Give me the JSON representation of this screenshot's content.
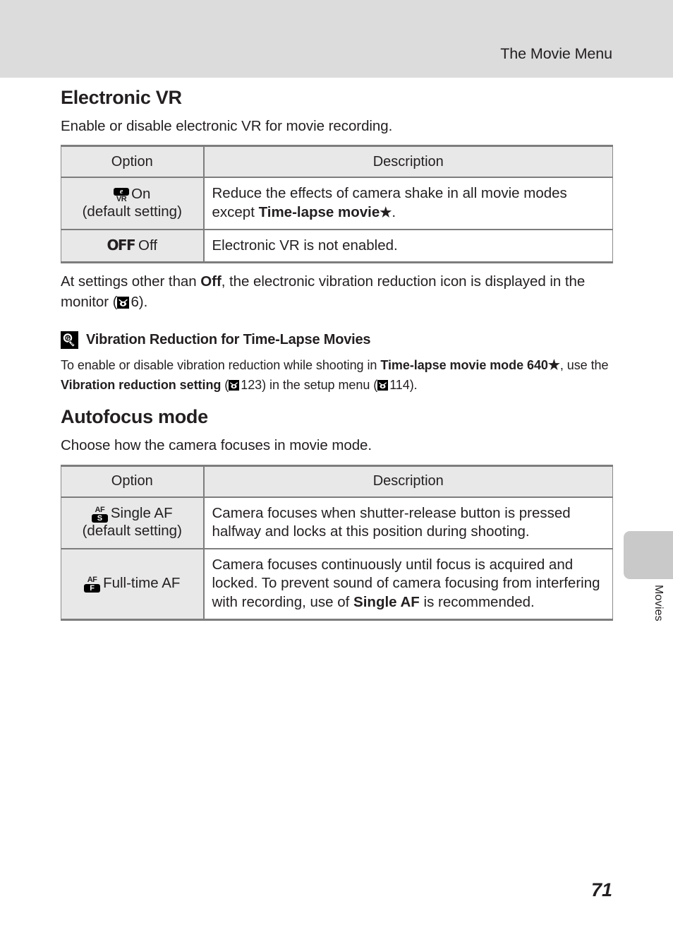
{
  "header": {
    "title": "The Movie Menu"
  },
  "sections": [
    {
      "id": "electronic-vr",
      "title": "Electronic VR",
      "lead": "Enable or disable electronic VR for movie recording.",
      "table": {
        "columns": [
          "Option",
          "Description"
        ],
        "rows": [
          {
            "icon": "vr-on-icon",
            "icon_top": "e",
            "icon_bottom": "VR",
            "option": "On",
            "option_sub": "(default setting)",
            "description_pre": "Reduce the effects of camera shake in all movie modes except ",
            "description_bold": "Time-lapse movie",
            "description_star": "★",
            "description_post": "."
          },
          {
            "icon": "off-icon",
            "icon_glyph": "OFF",
            "option": "Off",
            "option_sub": "",
            "description_pre": "Electronic VR is not enabled.",
            "description_bold": "",
            "description_star": "",
            "description_post": ""
          }
        ]
      },
      "after_table": {
        "pre": "At settings other than ",
        "bold": "Off",
        "mid": ", the electronic vibration reduction icon is displayed in the monitor (",
        "xref_page": "6",
        "post": ")."
      }
    },
    {
      "id": "autofocus-mode",
      "title": "Autofocus mode",
      "lead": "Choose how the camera focuses in movie mode.",
      "table": {
        "columns": [
          "Option",
          "Description"
        ],
        "rows": [
          {
            "icon": "af-single-icon",
            "icon_top": "AF",
            "icon_bottom": "S",
            "option": "Single AF",
            "option_sub": "(default setting)",
            "description_pre": "Camera focuses when shutter-release button is pressed halfway and locks at this position during shooting.",
            "description_bold": "",
            "description_post": ""
          },
          {
            "icon": "af-full-icon",
            "icon_top": "AF",
            "icon_bottom": "F",
            "option": "Full-time AF",
            "option_sub": "",
            "description_pre": "Camera focuses continuously until focus is acquired and locked. To prevent sound of camera focusing from interfering with recording, use of ",
            "description_bold": "Single AF",
            "description_post": " is recommended."
          }
        ]
      }
    }
  ],
  "tip": {
    "icon": "lightbulb-icon",
    "title": "Vibration Reduction for Time-Lapse Movies",
    "body_1": "To enable or disable vibration reduction while shooting in ",
    "body_bold_1": "Time-lapse movie mode 640",
    "body_star": "★",
    "body_2": ", use the ",
    "body_bold_2": "Vibration reduction setting",
    "body_3": " (",
    "xref_1": "123",
    "body_4": ") in the setup menu (",
    "xref_2": "114",
    "body_5": ")."
  },
  "thumb_tab": {
    "label": "Movies"
  },
  "footer": {
    "page_number": "71"
  },
  "colors": {
    "header_band": "#dcdcdc",
    "table_header_bg": "#e8e8e8",
    "table_border": "#7d7d7d",
    "thumb_tab": "#c9c9c9",
    "text": "#231f20"
  }
}
